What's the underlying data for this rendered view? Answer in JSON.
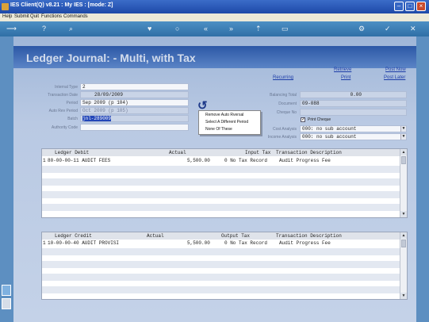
{
  "window": {
    "title": "IES Client(Q) v8.21 : My IES :       [mode: Z]"
  },
  "menu": {
    "items": [
      "Help",
      "Submit",
      "Quit",
      "Functions",
      "Commands"
    ]
  },
  "page": {
    "title": "Ledger Journal: - Multi, with Tax"
  },
  "links": {
    "recurring": "Recurring",
    "retrieve": "Retrieve",
    "print": "Print",
    "post_now": "Post Now",
    "post_later": "Post Later"
  },
  "form": {
    "internal_type": {
      "label": "Internal Type",
      "value": "2"
    },
    "transaction_date": {
      "label": "Transaction Date",
      "value": "28/09/2009"
    },
    "period": {
      "label": "Period",
      "value": "Sep 2009 (p 104)"
    },
    "auto_rev_period": {
      "label": "Auto Rev Period",
      "value": "Oct 2009 (p 105)"
    },
    "batch": {
      "label": "Batch",
      "value": "jnl-289009"
    },
    "authority_code": {
      "label": "Authority Code",
      "value": ""
    },
    "balancing_total": {
      "label": "Balancing Total",
      "value": "0.00"
    },
    "document": {
      "label": "Document",
      "value": "09-088"
    },
    "cheque_no": {
      "label": "Cheque No",
      "value": ""
    },
    "print_cheque": {
      "label": "Print Cheque",
      "checked": true
    },
    "cost_analysis": {
      "label": "Cost Analysis",
      "value": "000: no sub account"
    },
    "income_analysis": {
      "label": "Income Analysis",
      "value": "000: no sub account"
    }
  },
  "popup_menu": {
    "items": [
      "Remove Auto Rversal",
      "Select A Different Period",
      "None Of These"
    ]
  },
  "debit_grid": {
    "columns": [
      "Ledger Debit",
      "Actual",
      "Input Tax",
      "Transaction Description"
    ],
    "rows": [
      {
        "num": "1",
        "ledger": "80-00-00-11 AUDIT FEES",
        "actual": "5,500.00",
        "tax": "0 No Tax Record",
        "description": "Audit Progress Fee"
      }
    ]
  },
  "credit_grid": {
    "columns": [
      "Ledger Credit",
      "Actual",
      "Output Tax",
      "Transaction Description"
    ],
    "rows": [
      {
        "num": "1",
        "ledger": "10-00-00-40 AUDIT PROVISI",
        "actual": "5,500.00",
        "tax": "0 No Tax Record",
        "description": "Audit Progress Fee"
      }
    ]
  }
}
